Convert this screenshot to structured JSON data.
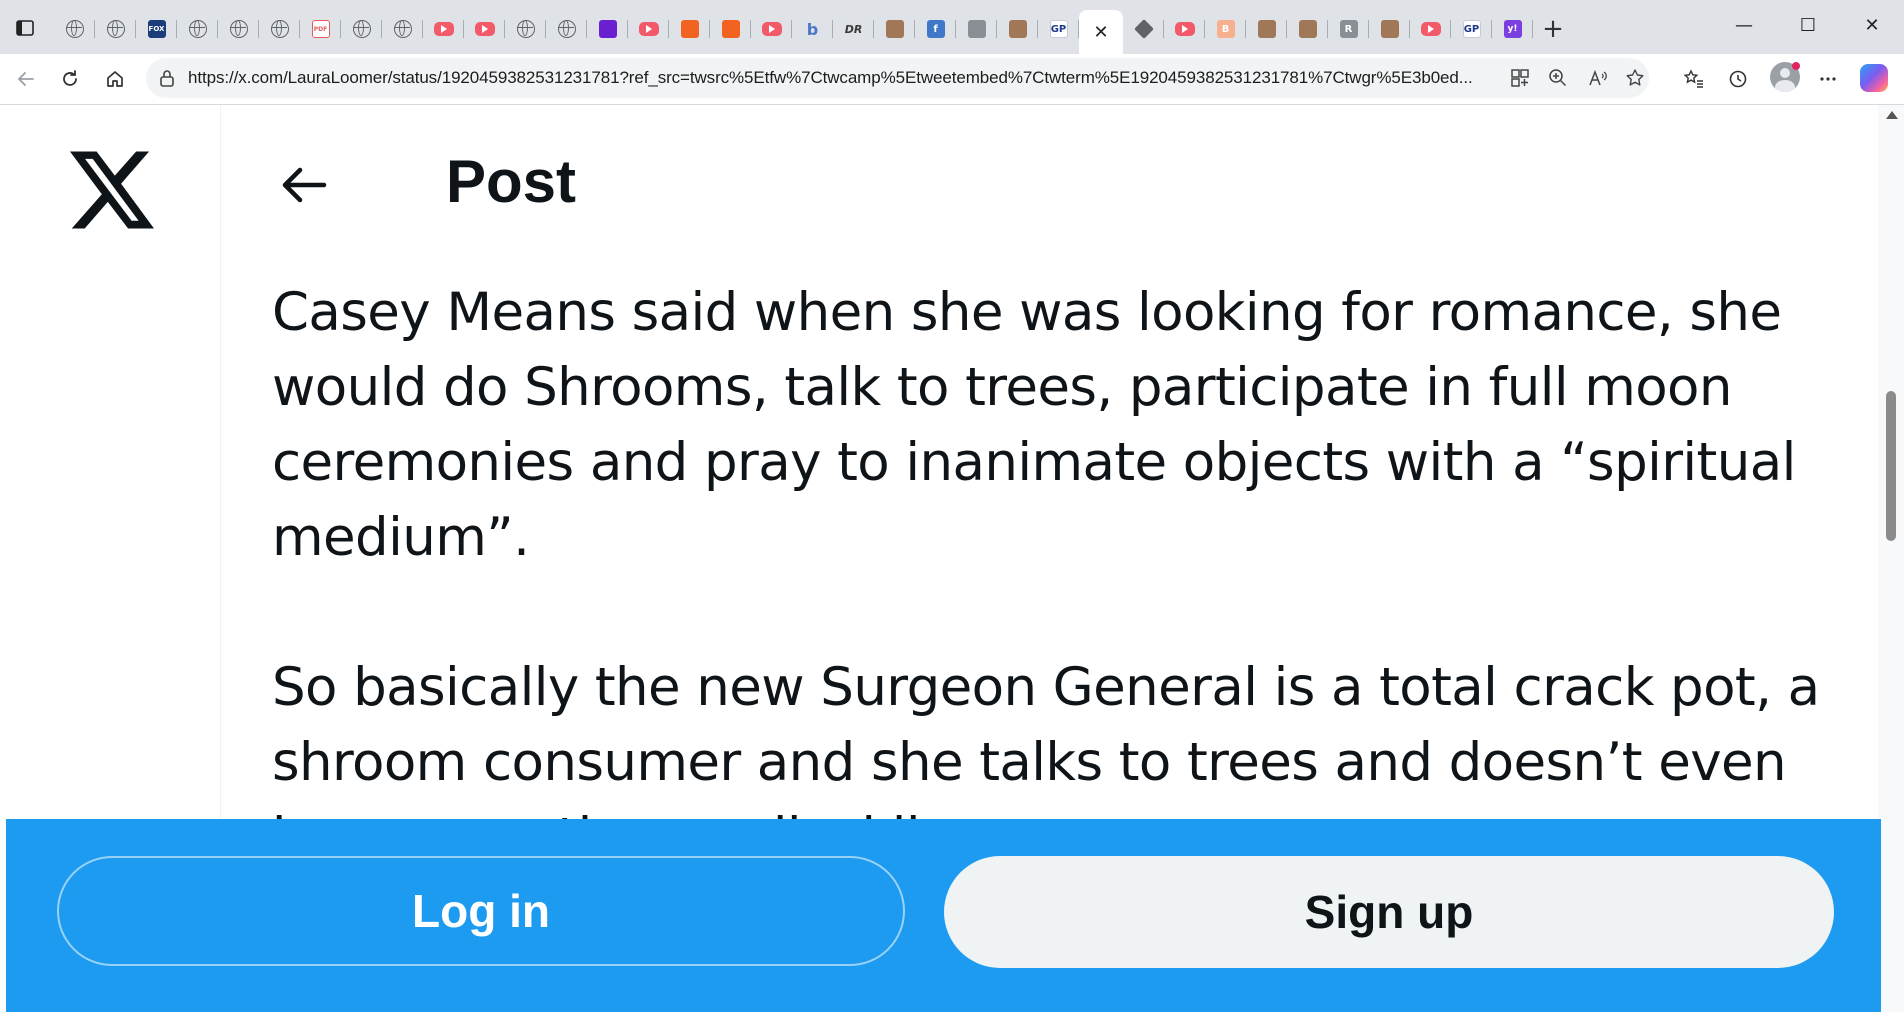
{
  "browser": {
    "tabs": [
      {
        "icon": "globe-icon"
      },
      {
        "icon": "globe-icon"
      },
      {
        "icon": "news-icon",
        "text": "FOX"
      },
      {
        "icon": "globe-icon"
      },
      {
        "icon": "globe-icon"
      },
      {
        "icon": "globe-icon"
      },
      {
        "icon": "pdf-icon",
        "text": "PDF"
      },
      {
        "icon": "globe-icon"
      },
      {
        "icon": "globe-icon"
      },
      {
        "icon": "youtube-icon"
      },
      {
        "icon": "youtube-icon"
      },
      {
        "icon": "globe-icon"
      },
      {
        "icon": "globe-icon"
      },
      {
        "icon": "mail-icon"
      },
      {
        "icon": "youtube-icon"
      },
      {
        "icon": "bookmark-icon"
      },
      {
        "icon": "bookmark-icon"
      },
      {
        "icon": "youtube-icon"
      },
      {
        "icon": "bing-icon",
        "text": "b"
      },
      {
        "icon": "dr-icon",
        "text": "DR"
      },
      {
        "icon": "photo-icon"
      },
      {
        "icon": "facebook-icon",
        "text": "f"
      },
      {
        "icon": "seal-icon"
      },
      {
        "icon": "photo-icon"
      },
      {
        "icon": "gp-icon",
        "text": "GP"
      }
    ],
    "active_tab": {
      "close_label": "✕"
    },
    "tabs_after": [
      {
        "icon": "diamond-icon"
      },
      {
        "icon": "youtube-icon"
      },
      {
        "icon": "blogger-icon",
        "text": "B"
      },
      {
        "icon": "photo-icon"
      },
      {
        "icon": "photo-icon"
      },
      {
        "icon": "r-icon",
        "text": "R"
      },
      {
        "icon": "photo-icon"
      },
      {
        "icon": "youtube-icon"
      },
      {
        "icon": "gp-icon",
        "text": "GP"
      },
      {
        "icon": "yahoo-icon",
        "text": "y!"
      }
    ],
    "new_tab_label": "+",
    "window": {
      "minimize": "—",
      "maximize": "☐",
      "close": "✕"
    },
    "url": "https://x.com/LauraLoomer/status/1920459382531231781?ref_src=twsrc%5Etfw%7Ctwcamp%5Etweetembed%7Ctwterm%5E1920459382531231781%7Ctwgr%5E3b0ed..."
  },
  "page": {
    "title": "Post",
    "tweet_paragraphs": [
      "Casey Means said when she was looking for romance, she would do Shrooms, talk to trees, participate in full moon ceremonies and pray to inanimate objects with a “spiritual medium”.",
      "So basically the new Surgeon General is a total crack pot, a shroom consumer and she talks to trees and doesn’t even have an active medical license."
    ]
  },
  "login_bar": {
    "login_label": "Log in",
    "signup_label": "Sign up"
  },
  "colors": {
    "accent": "#1d9bf0",
    "text": "#0f1419",
    "signup_bg": "#eff3f4"
  }
}
